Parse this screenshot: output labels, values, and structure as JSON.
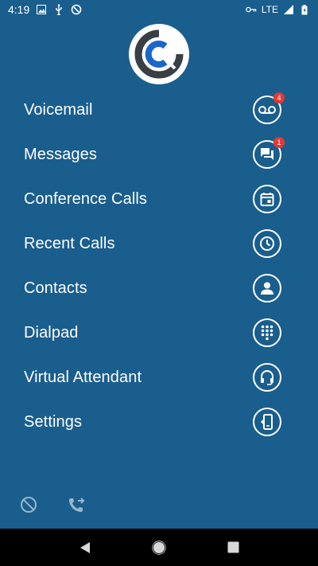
{
  "status_bar": {
    "time": "4:19",
    "network": "LTE"
  },
  "menu": {
    "items": [
      {
        "label": "Voicemail",
        "badge": "4",
        "icon": "voicemail-icon"
      },
      {
        "label": "Messages",
        "badge": "1",
        "icon": "chat-icon"
      },
      {
        "label": "Conference Calls",
        "icon": "calendar-icon"
      },
      {
        "label": "Recent Calls",
        "icon": "clock-icon"
      },
      {
        "label": "Contacts",
        "icon": "person-icon"
      },
      {
        "label": "Dialpad",
        "icon": "dialpad-icon"
      },
      {
        "label": "Virtual Attendant",
        "icon": "headset-icon"
      },
      {
        "label": "Settings",
        "icon": "settings-phone-icon"
      }
    ]
  },
  "colors": {
    "background": "#1a5e8e",
    "badge": "#e53935",
    "logo_blue": "#1b66c9",
    "logo_gray": "#3a3f45"
  }
}
